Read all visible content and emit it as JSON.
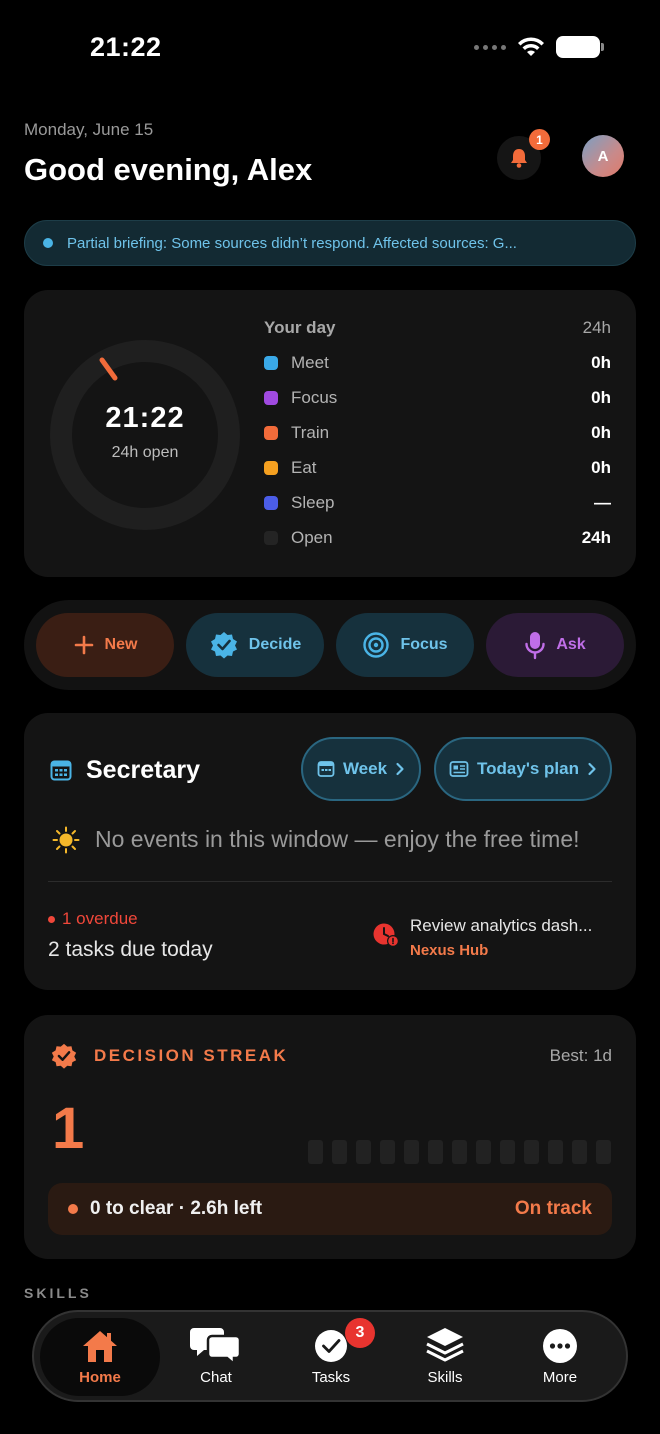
{
  "status_bar": {
    "time": "21:22"
  },
  "header": {
    "date": "Monday, June 15",
    "greeting": "Good evening, Alex",
    "notification_count": "1",
    "avatar_initial": "A"
  },
  "banner": {
    "text": "Partial briefing: Some sources didn’t respond. Affected sources: G..."
  },
  "day_card": {
    "ring_time": "21:22",
    "ring_subtitle": "24h open",
    "title": "Your day",
    "total": "24h",
    "rows": [
      {
        "label": "Meet",
        "value": "0h",
        "color": "#3aa9e8"
      },
      {
        "label": "Focus",
        "value": "0h",
        "color": "#a04ae0"
      },
      {
        "label": "Train",
        "value": "0h",
        "color": "#f26b3a"
      },
      {
        "label": "Eat",
        "value": "0h",
        "color": "#f5a020"
      },
      {
        "label": "Sleep",
        "value": "—",
        "color": "#4b5de8"
      },
      {
        "label": "Open",
        "value": "24h",
        "color": "#242424"
      }
    ]
  },
  "actions": {
    "new_label": "New",
    "decide_label": "Decide",
    "focus_label": "Focus",
    "ask_label": "Ask"
  },
  "secretary": {
    "title": "Secretary",
    "week_label": "Week",
    "plan_label": "Today's plan",
    "no_events": "No events in this window — enjoy the free time!",
    "overdue": "1 overdue",
    "due_today": "2 tasks due today",
    "task_title": "Review analytics dash...",
    "task_source": "Nexus Hub"
  },
  "streak": {
    "title": "DECISION STREAK",
    "best": "Best: 1d",
    "count": "1",
    "summary": "0 to clear · 2.6h left",
    "status": "On track",
    "days_active": [
      false,
      false,
      false,
      false,
      false,
      false,
      false,
      false,
      false,
      false,
      false,
      false,
      false,
      true
    ]
  },
  "skills": {
    "label": "SKILLS"
  },
  "tabbar": {
    "home": "Home",
    "chat": "Chat",
    "tasks": "Tasks",
    "tasks_badge": "3",
    "skills": "Skills",
    "more": "More"
  },
  "colors": {
    "accent_orange": "#f37a4a",
    "accent_blue": "#6fc3ea",
    "accent_purple": "#c06ee8",
    "danger_red": "#f0473a"
  }
}
